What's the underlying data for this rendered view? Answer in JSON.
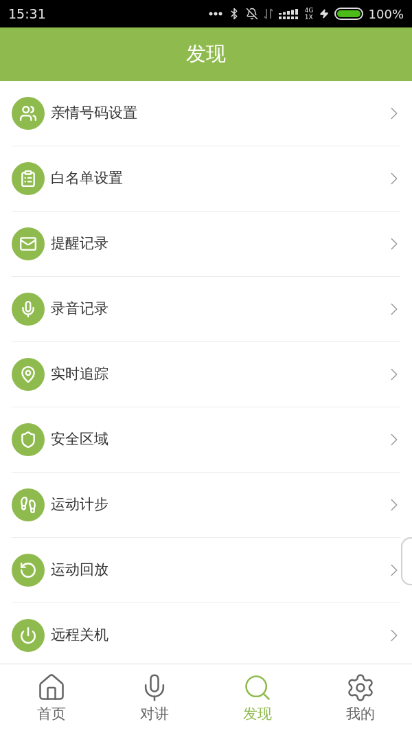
{
  "status_bar": {
    "time": "15:31",
    "network": "4G",
    "network_sub": "1X",
    "battery": "100%"
  },
  "header": {
    "title": "发现"
  },
  "menu": [
    {
      "kind": "family",
      "label": "亲情号码设置"
    },
    {
      "kind": "clipboard",
      "label": "白名单设置"
    },
    {
      "kind": "mail",
      "label": "提醒记录"
    },
    {
      "kind": "mic",
      "label": "录音记录"
    },
    {
      "kind": "pin",
      "label": "实时追踪"
    },
    {
      "kind": "shield",
      "label": "安全区域"
    },
    {
      "kind": "shoe",
      "label": "运动计步"
    },
    {
      "kind": "replay",
      "label": "运动回放"
    },
    {
      "kind": "power",
      "label": "远程关机"
    }
  ],
  "tab_bar": [
    {
      "kind": "home",
      "label": "首页",
      "selected": false
    },
    {
      "kind": "mic",
      "label": "对讲",
      "selected": false
    },
    {
      "kind": "search",
      "label": "发现",
      "selected": true
    },
    {
      "kind": "gear",
      "label": "我的",
      "selected": false
    }
  ]
}
